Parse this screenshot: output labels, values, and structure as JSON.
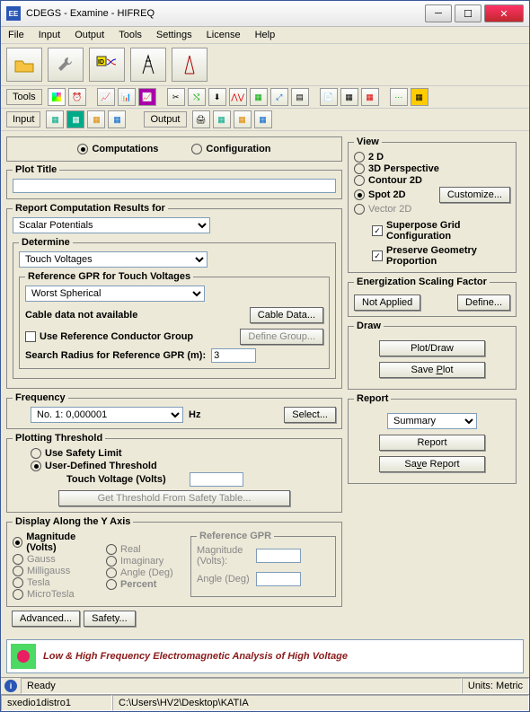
{
  "window": {
    "title": "CDEGS - Examine - HIFREQ"
  },
  "menu": [
    "File",
    "Input",
    "Output",
    "Tools",
    "Settings",
    "License",
    "Help"
  ],
  "toolbar_row": {
    "tools_label": "Tools"
  },
  "io_row": {
    "input": "Input",
    "output": "Output"
  },
  "tabs": {
    "computations": "Computations",
    "configuration": "Configuration"
  },
  "plot_title": {
    "legend": "Plot Title",
    "value": ""
  },
  "report_results": {
    "legend": "Report Computation Results for",
    "select": "Scalar Potentials",
    "determine": {
      "legend": "Determine",
      "select": "Touch Voltages",
      "ref_gpr": {
        "legend": "Reference GPR for Touch Voltages",
        "select": "Worst Spherical",
        "cable_msg": "Cable data not available",
        "cable_btn": "Cable Data...",
        "use_ref": "Use Reference Conductor Group",
        "define_group": "Define Group...",
        "search_radius_lbl": "Search Radius for Reference GPR (m):",
        "search_radius_val": "3"
      }
    }
  },
  "frequency": {
    "legend": "Frequency",
    "select": "No. 1:  0,000001",
    "unit": "Hz",
    "select_btn": "Select..."
  },
  "plotting": {
    "legend": "Plotting Threshold",
    "use_safety": "Use Safety Limit",
    "user_defined": "User-Defined Threshold",
    "touch_voltage_lbl": "Touch Voltage (Volts)",
    "touch_voltage_val": "",
    "get_threshold": "Get Threshold From Safety Table..."
  },
  "yaxis": {
    "legend": "Display Along the Y Axis",
    "left": [
      "Magnitude (Volts)",
      "Gauss",
      "Milligauss",
      "Tesla",
      "MicroTesla"
    ],
    "right": [
      "",
      "Real",
      "Imaginary",
      "Angle (Deg)",
      "Percent"
    ],
    "ref_gpr_lbl": "Reference GPR",
    "mag_lbl": "Magnitude (Volts):",
    "angle_lbl": "Angle (Deg)"
  },
  "advanced_btn": "Advanced...",
  "safety_btn": "Safety...",
  "view": {
    "legend": "View",
    "opts": [
      "2 D",
      "3D Perspective",
      "Contour 2D",
      "Spot 2D",
      "Vector 2D"
    ],
    "customize": "Customize...",
    "superpose": "Superpose Grid Configuration",
    "preserve": "Preserve Geometry Proportion"
  },
  "energ": {
    "legend": "Energization Scaling Factor",
    "not_applied": "Not Applied",
    "define": "Define..."
  },
  "draw": {
    "legend": "Draw",
    "plot": "Plot/Draw",
    "save": "Save Plot"
  },
  "report": {
    "legend": "Report",
    "select": "Summary",
    "report_btn": "Report",
    "save_btn": "Save Report"
  },
  "banner": "Low & High Frequency Electromagnetic Analysis of High Voltage",
  "status": {
    "ready": "Ready",
    "units": "Units: Metric",
    "file1": "sxedio1distro1",
    "path": "C:\\Users\\HV2\\Desktop\\KATIA"
  }
}
